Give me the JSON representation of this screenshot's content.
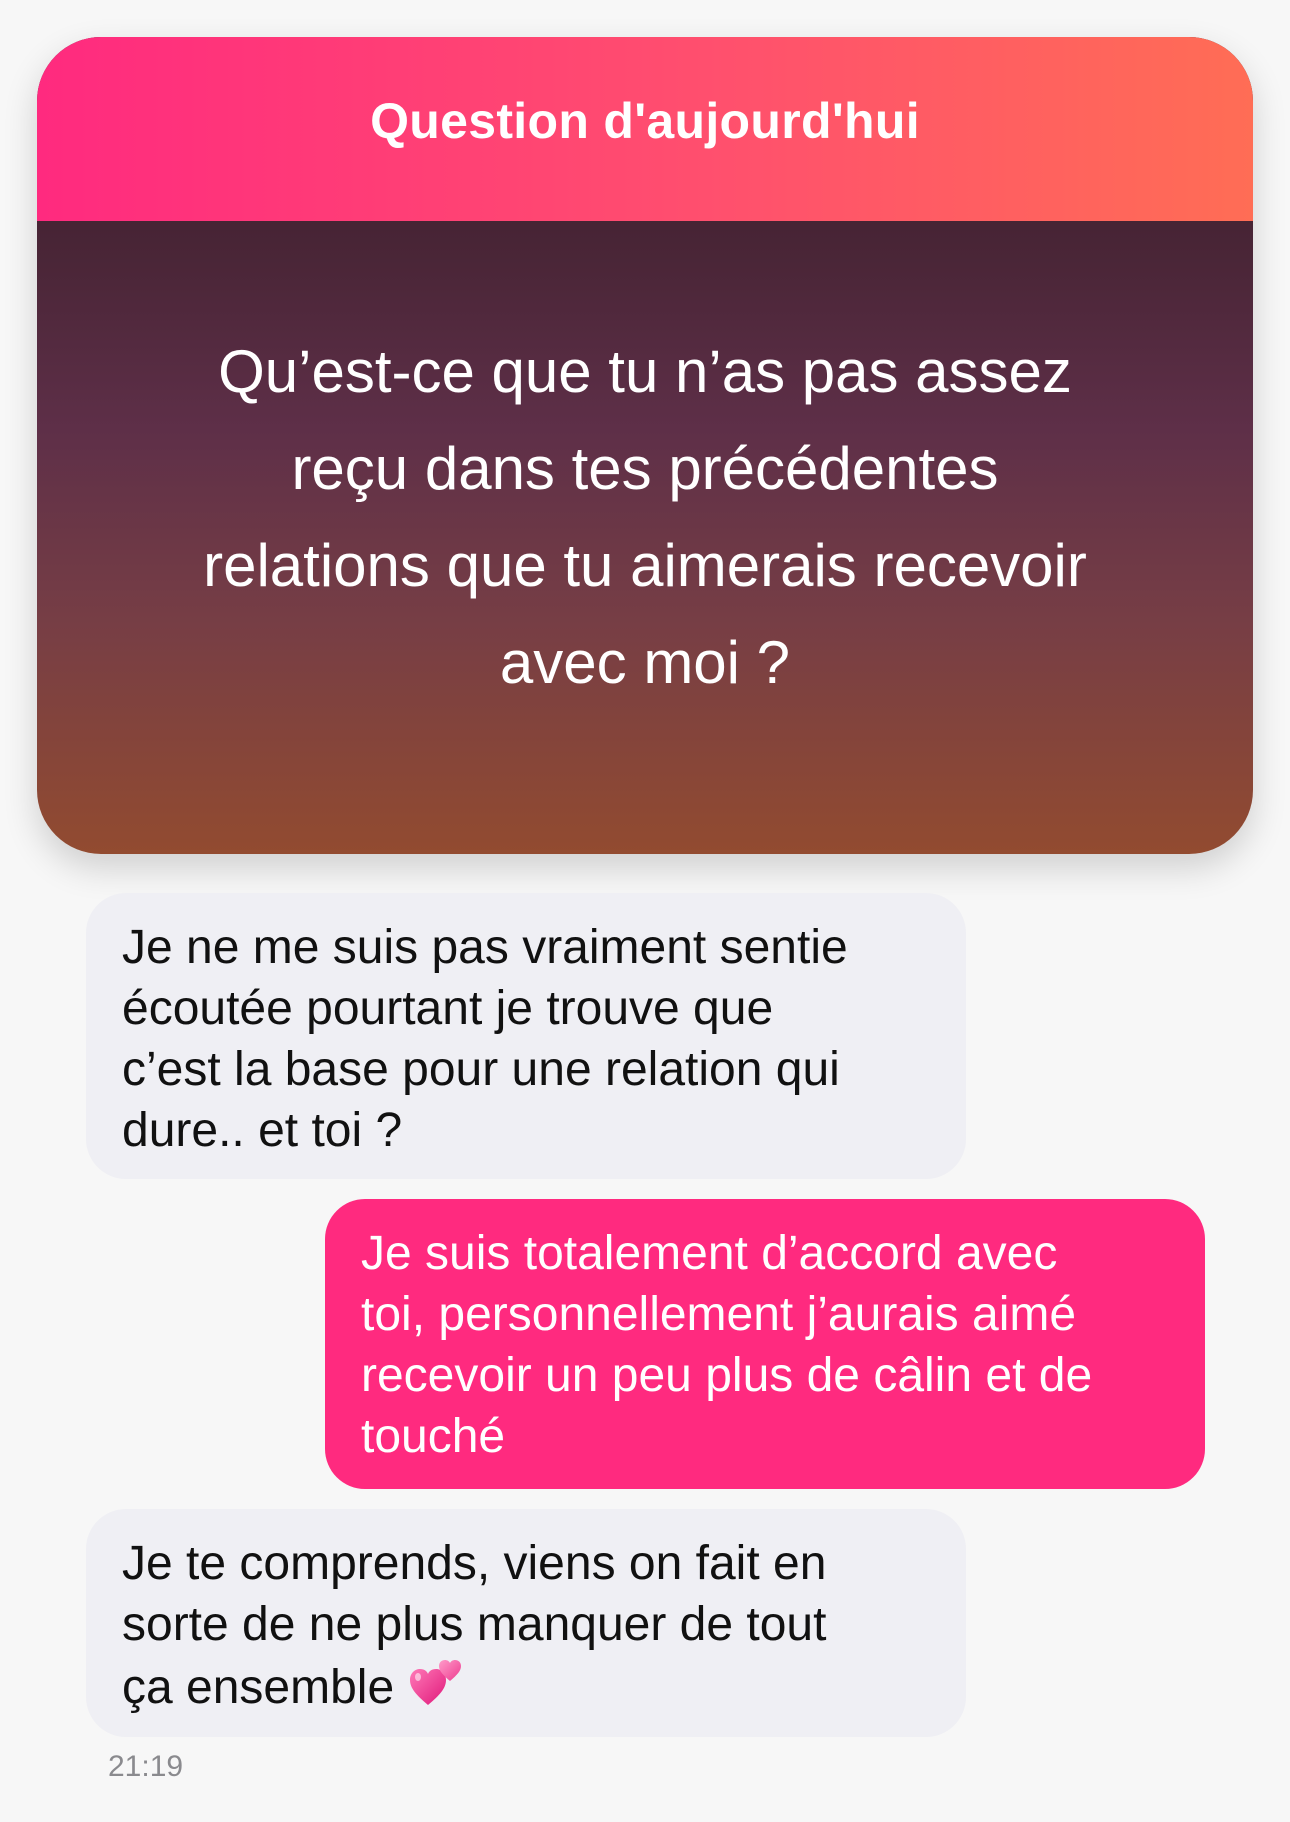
{
  "question_card": {
    "header_title": "Question d'aujourd'hui",
    "question_lines": [
      "Qu’est-ce que tu n’as pas assez",
      "reçu dans tes précédentes",
      "relations que tu aimerais recevoir",
      "avec moi ?"
    ],
    "colors": {
      "header_gradient_start": "#ff2a7f",
      "header_gradient_end": "#ff6d55",
      "body_gradient_top": "#331b25",
      "body_gradient_bottom": "#924b30"
    }
  },
  "messages": [
    {
      "direction": "received",
      "lines": [
        "Je ne me suis pas vraiment sentie",
        "écoutée pourtant je trouve que",
        "c’est la base pour une relation qui",
        "dure.. et toi ?"
      ]
    },
    {
      "direction": "sent",
      "lines": [
        "Je suis totalement d’accord avec",
        "toi, personnellement j’aurais aimé",
        "recevoir un peu plus de câlin et de",
        "touché"
      ]
    },
    {
      "direction": "received",
      "lines": [
        "Je te comprends, viens on fait en",
        "sorte de ne plus manquer de tout",
        "ça ensemble"
      ],
      "emoji": "two-hearts-icon"
    }
  ],
  "timestamp": "21:19",
  "colors": {
    "sent_bubble": "#ff2a7f",
    "received_bubble": "#efeff4",
    "background": "#f7f7f7"
  }
}
